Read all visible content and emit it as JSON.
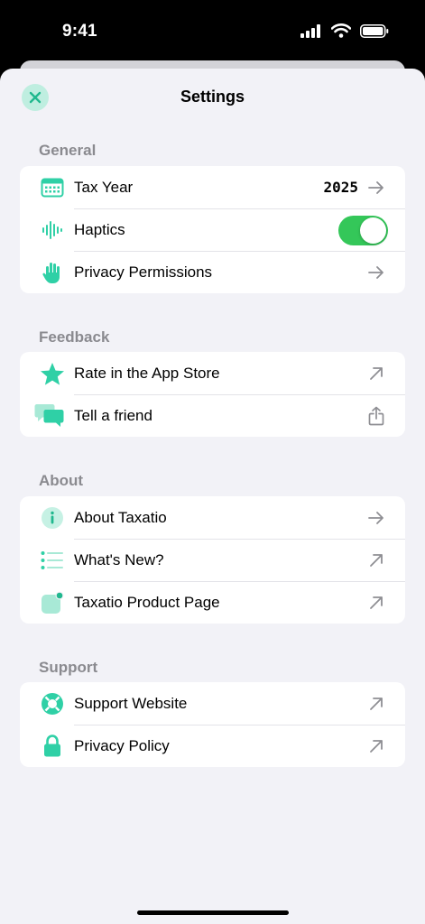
{
  "status_bar": {
    "time": "9:41"
  },
  "sheet": {
    "title": "Settings"
  },
  "sections": {
    "general": {
      "header": "General",
      "tax_year_label": "Tax Year",
      "tax_year_value": "2025",
      "haptics_label": "Haptics",
      "haptics_on": true,
      "privacy_label": "Privacy Permissions"
    },
    "feedback": {
      "header": "Feedback",
      "rate_label": "Rate in the App Store",
      "tell_label": "Tell a friend"
    },
    "about": {
      "header": "About",
      "about_label": "About Taxatio",
      "whats_new_label": "What's New?",
      "product_page_label": "Taxatio Product Page"
    },
    "support": {
      "header": "Support",
      "website_label": "Support Website",
      "privacy_policy_label": "Privacy Policy"
    }
  },
  "colors": {
    "accent": "#2fd0a6",
    "toggle_on": "#34c759",
    "chevron": "#8e8e93"
  },
  "icons": {
    "tax_year": "calendar-icon",
    "haptics": "waveform-icon",
    "privacy": "hand-raised-icon",
    "rate": "star-icon",
    "tell": "chat-bubbles-icon",
    "about": "info-icon",
    "whats_new": "list-icon",
    "product_page": "app-badge-icon",
    "website": "lifebuoy-icon",
    "privacy_policy": "lock-icon"
  }
}
